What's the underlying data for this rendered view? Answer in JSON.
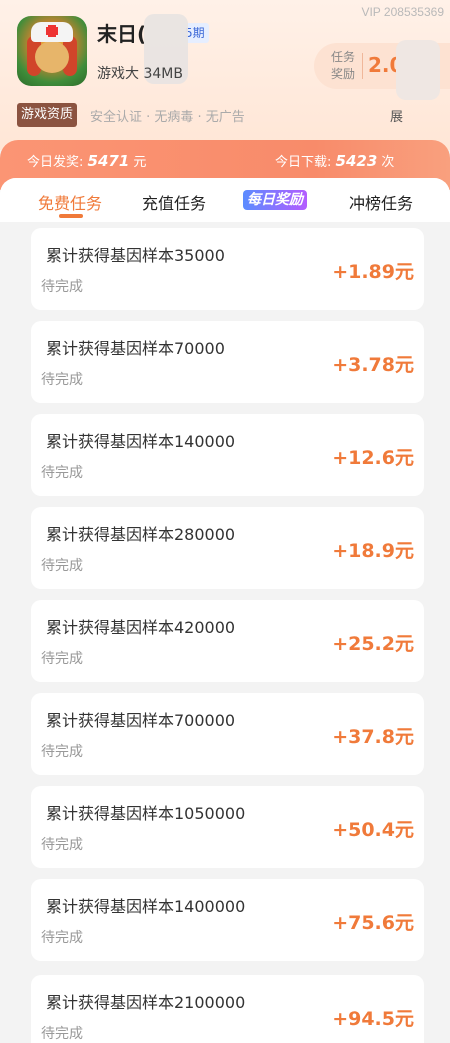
{
  "vip_id": "VIP 208535369",
  "app": {
    "title": "末日(",
    "period": "5期",
    "meta": "游戏大      34MB",
    "reward_label": "任务\n奖励",
    "reward_value": "2.0"
  },
  "tags": {
    "qualification": "游戏资质",
    "text": "安全认证 · 无病毒 · 无广告",
    "expand": "展"
  },
  "stats": {
    "today_prize_label": "今日发奖:",
    "today_prize_value": "5471",
    "today_prize_unit": "元",
    "today_download_label": "今日下载:",
    "today_download_value": "5423",
    "today_download_unit": "次"
  },
  "tabs": {
    "free": "免费任务",
    "recharge": "充值任务",
    "daily": "每日奖励",
    "rank": "冲榜任务"
  },
  "tasks": [
    {
      "name": "累计获得基因样本35000",
      "status": "待完成",
      "amount": "+1.89元"
    },
    {
      "name": "累计获得基因样本70000",
      "status": "待完成",
      "amount": "+3.78元"
    },
    {
      "name": "累计获得基因样本140000",
      "status": "待完成",
      "amount": "+12.6元"
    },
    {
      "name": "累计获得基因样本280000",
      "status": "待完成",
      "amount": "+18.9元"
    },
    {
      "name": "累计获得基因样本420000",
      "status": "待完成",
      "amount": "+25.2元"
    },
    {
      "name": "累计获得基因样本700000",
      "status": "待完成",
      "amount": "+37.8元"
    },
    {
      "name": "累计获得基因样本1050000",
      "status": "待完成",
      "amount": "+50.4元"
    },
    {
      "name": "累计获得基因样本1400000",
      "status": "待完成",
      "amount": "+75.6元"
    },
    {
      "name": "累计获得基因样本2100000",
      "status": "待完成",
      "amount": "+94.5元"
    }
  ]
}
